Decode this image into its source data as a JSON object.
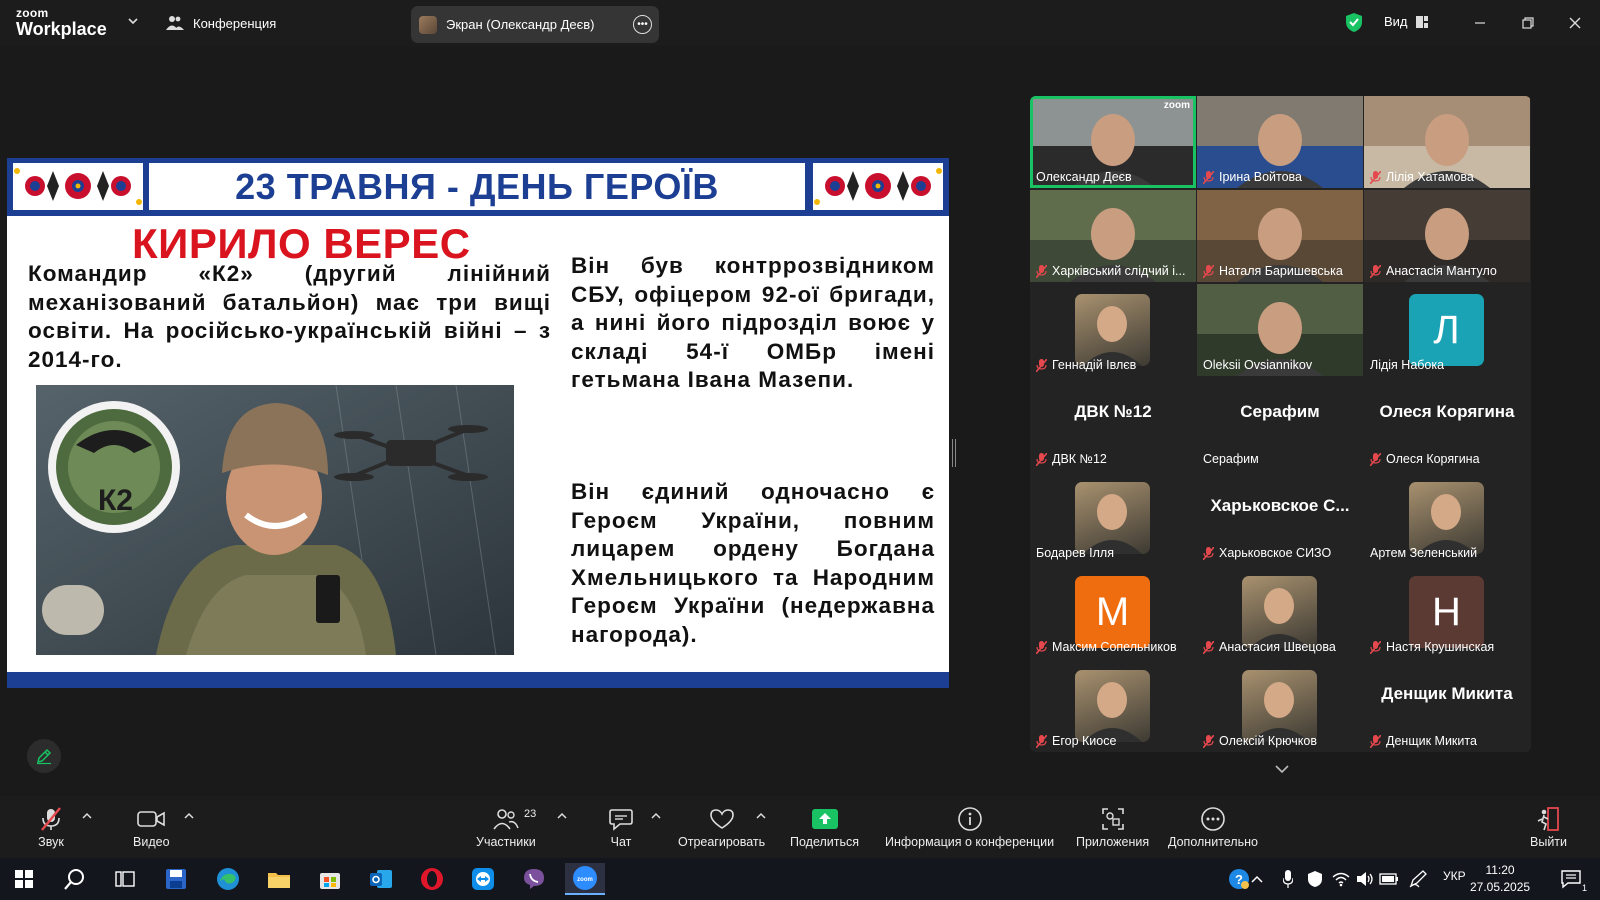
{
  "app": {
    "logo_line1": "zoom",
    "logo_line2": "Workplace",
    "conference_label": "Конференция",
    "screen_share_label": "Экран (Олександр Деєв)",
    "view_label": "Вид"
  },
  "slide": {
    "banner_title": "23 ТРАВНЯ - ДЕНЬ ГЕРОЇВ",
    "name": "КИРИЛО ВЕРЕС",
    "paragraph1": "Командир «К2» (другий лінійний механізований батальйон) має три вищі освіти. На російсько-українській війні – з 2014-го.",
    "paragraph2": "Він був контррозвідником СБУ, офіцером 92-ої бригади, а нині його підрозділ воює у складі 54-ї ОМБр імені гетьмана Івана Мазепи.",
    "paragraph3": "Він єдиний одночасно є Героєм України, повним лицарем ордену Богдана Хмельницького та Народним Героєм України (недержавна нагорода).",
    "patch_text": "К2"
  },
  "participants": [
    {
      "name": "Олександр Деєв",
      "type": "video",
      "muted": false,
      "active": true,
      "tile_label": "zoom"
    },
    {
      "name": "Ірина Войтова",
      "type": "video",
      "muted": true
    },
    {
      "name": "Лілія Хатамова",
      "type": "video",
      "muted": true
    },
    {
      "name": "Харківський слідчий і...",
      "type": "video",
      "muted": true
    },
    {
      "name": "Наталя Баришевська",
      "type": "video",
      "muted": true
    },
    {
      "name": "Анастасія Мантуло",
      "type": "video",
      "muted": true
    },
    {
      "name": "Геннадій Івлєв",
      "type": "avatar",
      "muted": true
    },
    {
      "name": "Oleksii Ovsiannikov",
      "type": "video",
      "muted": false
    },
    {
      "name": "Лідія Набока",
      "type": "letter",
      "letter": "Л",
      "color": "#1aa3b5",
      "muted": false
    },
    {
      "name": "ДВК №12",
      "type": "text",
      "big": "ДВК №12",
      "muted": true
    },
    {
      "name": "Серафим",
      "type": "text",
      "big": "Серафим",
      "muted": false
    },
    {
      "name": "Олеся Корягина",
      "type": "text",
      "big": "Олеся Корягина",
      "muted": true
    },
    {
      "name": "Бодарев Ілля",
      "type": "avatar",
      "muted": false
    },
    {
      "name": "Харьковское СИЗО",
      "type": "text",
      "big": "Харьковское С...",
      "muted": true
    },
    {
      "name": "Артем Зеленський",
      "type": "avatar",
      "muted": false
    },
    {
      "name": "Максим Сопельников",
      "type": "letter",
      "letter": "M",
      "color": "#f06d0f",
      "muted": true
    },
    {
      "name": "Анастасия Швецова",
      "type": "avatar",
      "muted": true
    },
    {
      "name": "Настя Крушинская",
      "type": "letter",
      "letter": "Н",
      "color": "#5a3a33",
      "muted": true
    },
    {
      "name": "Егор Киосе",
      "type": "avatar",
      "muted": true
    },
    {
      "name": "Олексій Крючков",
      "type": "avatar",
      "muted": true
    },
    {
      "name": "Денщик Микита",
      "type": "text",
      "big": "Денщик Микита",
      "muted": true
    }
  ],
  "toolbar": {
    "audio": "Звук",
    "video": "Видео",
    "participants": "Участники",
    "participants_count": "23",
    "chat": "Чат",
    "react": "Отреагировать",
    "share": "Поделиться",
    "info": "Информация о конференции",
    "apps": "Приложения",
    "more": "Дополнительно",
    "leave": "Выйти"
  },
  "taskbar": {
    "language": "УКР",
    "time": "11:20",
    "date": "27.05.2025",
    "notifications": "1"
  },
  "colors": {
    "slide_blue": "#1c3f94",
    "slide_red": "#d9141e",
    "active_speaker": "#19c363",
    "share_green": "#19c363",
    "mute_red": "#e5484d"
  }
}
